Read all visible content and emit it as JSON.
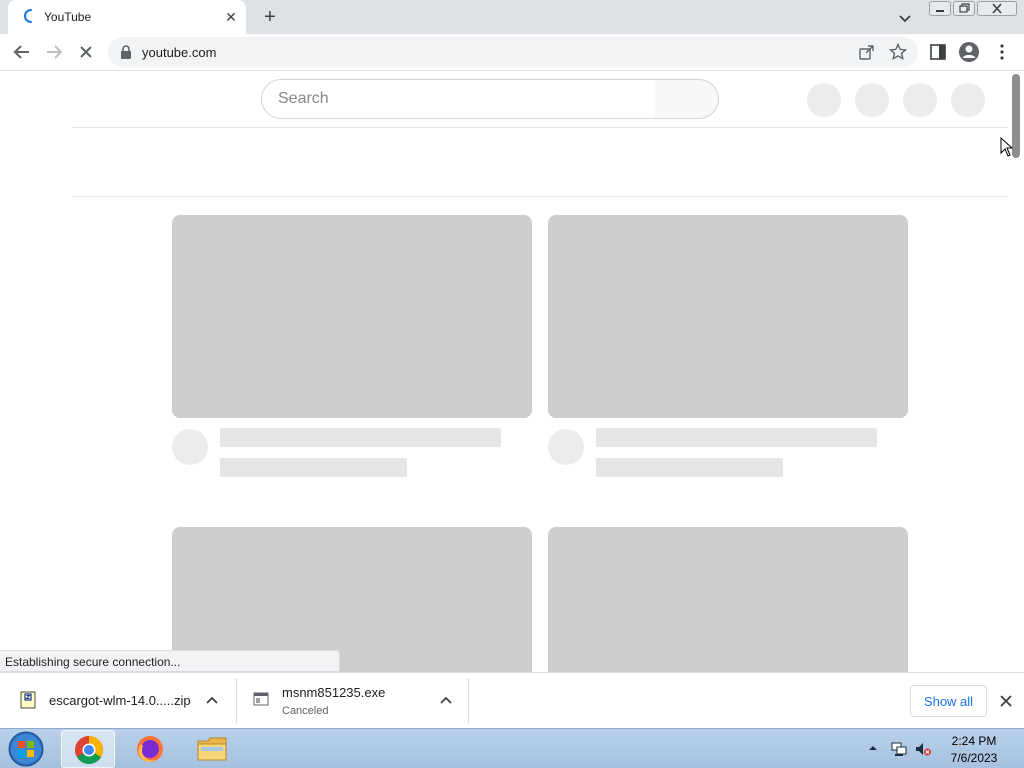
{
  "browser": {
    "tab": {
      "title": "YouTube",
      "close_glyph": "✕"
    },
    "new_tab_glyph": "+",
    "url": "youtube.com",
    "icons": [
      "loading-spinner-icon",
      "close-icon",
      "plus-icon",
      "chevron-down-icon",
      "minimize-icon",
      "restore-icon",
      "close-window-icon",
      "back-arrow-icon",
      "forward-arrow-icon",
      "stop-loading-icon",
      "lock-icon",
      "share-icon",
      "star-icon",
      "side-panel-icon",
      "profile-icon",
      "kebab-menu-icon"
    ]
  },
  "page": {
    "search_placeholder": "Search",
    "status_text": "Establishing secure connection..."
  },
  "downloads": {
    "items": [
      {
        "name": "escargot-wlm-14.0.....zip",
        "status": ""
      },
      {
        "name": "msnm851235.exe",
        "status": "Canceled"
      }
    ],
    "show_all_label": "Show all"
  },
  "taskbar": {
    "time": "2:24 PM",
    "date": "7/6/2023",
    "apps": [
      "chrome-icon",
      "firefox-icon",
      "file-explorer-icon"
    ]
  },
  "colors": {
    "tabstrip": "#dee1e6",
    "skeleton_thumb": "#cdcdcd",
    "skeleton_line": "#e5e5e5",
    "link_blue": "#1a73e8",
    "taskbar": "#b9d1ea"
  }
}
